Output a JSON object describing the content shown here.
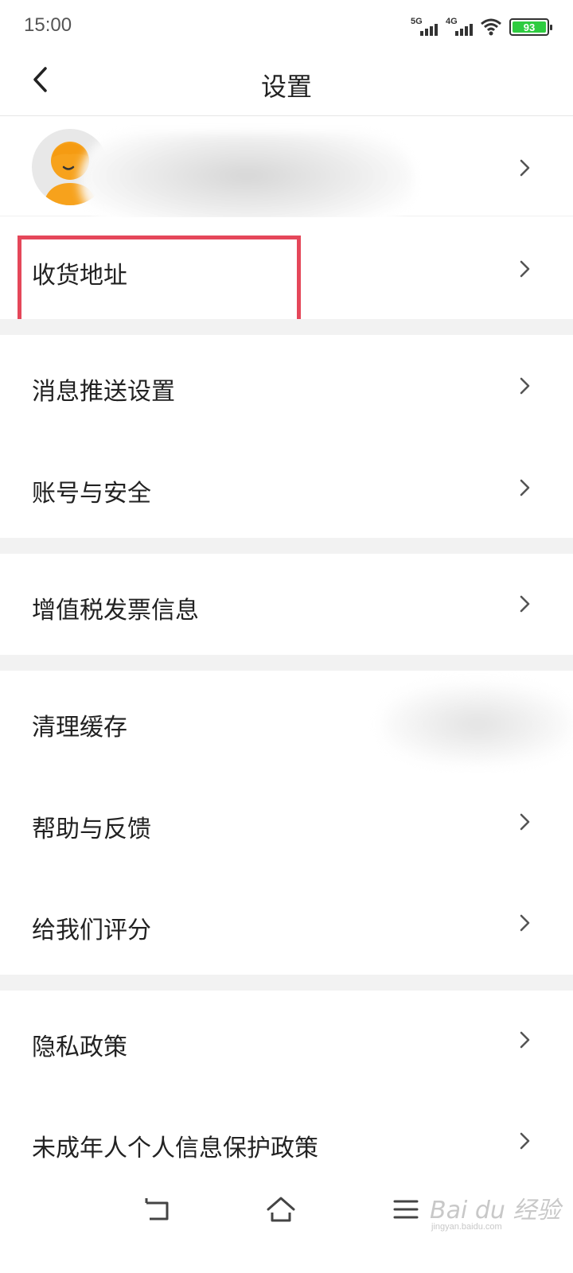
{
  "status_bar": {
    "time": "15:00",
    "signal_1": "5G",
    "signal_2": "4G",
    "battery": "93",
    "icons": [
      "signal-5g-icon",
      "signal-4g-icon",
      "wifi-icon",
      "battery-icon"
    ]
  },
  "header": {
    "title": "设置",
    "back_icon": "chevron-left-icon"
  },
  "profile": {
    "avatar_icon": "avatar-icon",
    "name": ""
  },
  "menu": {
    "address": "收货地址",
    "push_settings": "消息推送设置",
    "account_security": "账号与安全",
    "vat_invoice": "增值税发票信息",
    "clear_cache": "清理缓存",
    "help_feedback": "帮助与反馈",
    "rate_us": "给我们评分",
    "privacy_policy": "隐私政策",
    "minor_privacy_policy": "未成年人个人信息保护政策"
  },
  "navbar": {
    "icons": [
      "nav-back-icon",
      "nav-home-icon",
      "nav-menu-icon"
    ]
  },
  "watermark": {
    "logo": "Bai du 经验",
    "url": "jingyan.baidu.com"
  },
  "colors": {
    "highlight": "#e5475a",
    "divider_gap": "#f2f2f2",
    "avatar_orange": "#f7a21c",
    "battery_green": "#2ecc40"
  }
}
